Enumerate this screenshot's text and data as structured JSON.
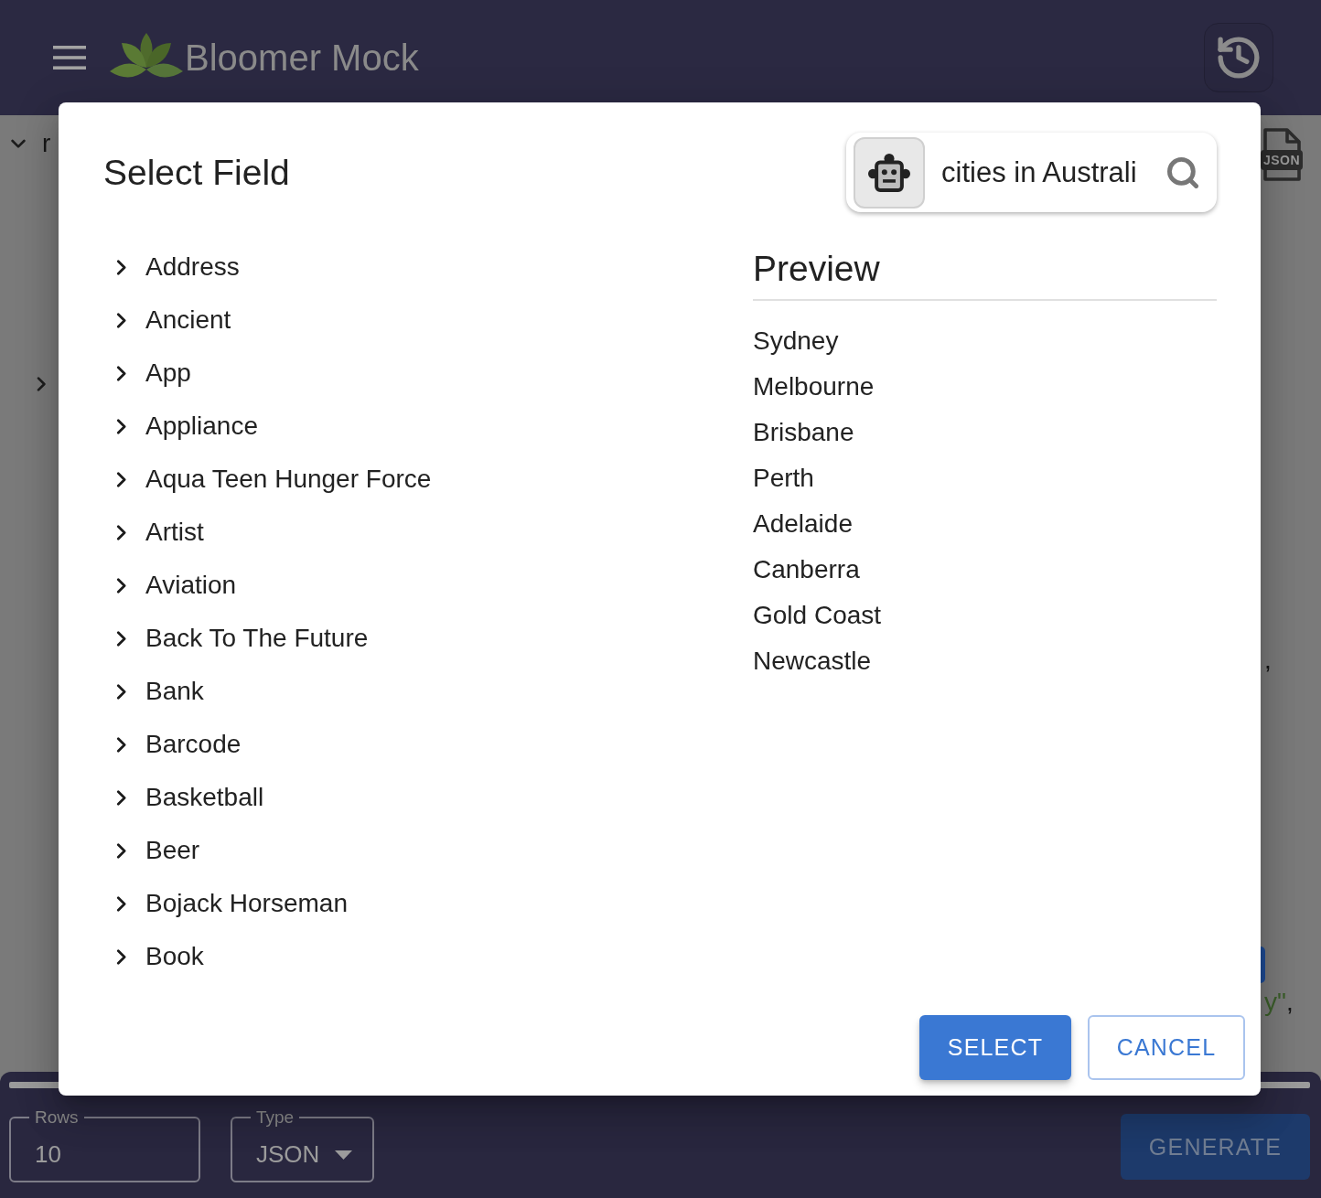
{
  "app_bar": {
    "title": "Bloomer Mock"
  },
  "background": {
    "tree": [
      {
        "label": "r",
        "expanded": true,
        "children": [
          {
            "expanded": false
          }
        ]
      }
    ],
    "file_badge": "JSON",
    "code_fragments": [
      {
        "punctuation": ","
      },
      {
        "string": "y\"",
        "punctuation": ","
      }
    ]
  },
  "dialog": {
    "title": "Select Field",
    "search": {
      "value": "cities in Australi"
    },
    "categories": [
      {
        "label": "Address",
        "expanded": false
      },
      {
        "label": "Ancient",
        "expanded": false
      },
      {
        "label": "App",
        "expanded": false
      },
      {
        "label": "Appliance",
        "expanded": false
      },
      {
        "label": "Aqua Teen Hunger Force",
        "expanded": false
      },
      {
        "label": "Artist",
        "expanded": false
      },
      {
        "label": "Aviation",
        "expanded": false
      },
      {
        "label": "Back To The Future",
        "expanded": false
      },
      {
        "label": "Bank",
        "expanded": false
      },
      {
        "label": "Barcode",
        "expanded": false
      },
      {
        "label": "Basketball",
        "expanded": false
      },
      {
        "label": "Beer",
        "expanded": false
      },
      {
        "label": "Bojack Horseman",
        "expanded": false
      },
      {
        "label": "Book",
        "expanded": false
      }
    ],
    "preview": {
      "title": "Preview",
      "items": [
        "Sydney",
        "Melbourne",
        "Brisbane",
        "Perth",
        "Adelaide",
        "Canberra",
        "Gold Coast",
        "Newcastle"
      ]
    },
    "buttons": [
      {
        "label": "SELECT",
        "kind": "primary"
      },
      {
        "label": "CANCEL",
        "kind": "outlined"
      }
    ]
  },
  "footer": {
    "fields": [
      {
        "label": "Rows",
        "value": "10",
        "kind": "text"
      },
      {
        "label": "Type",
        "value": "JSON",
        "kind": "select"
      }
    ],
    "generate_button": {
      "label": "GENERATE"
    }
  }
}
